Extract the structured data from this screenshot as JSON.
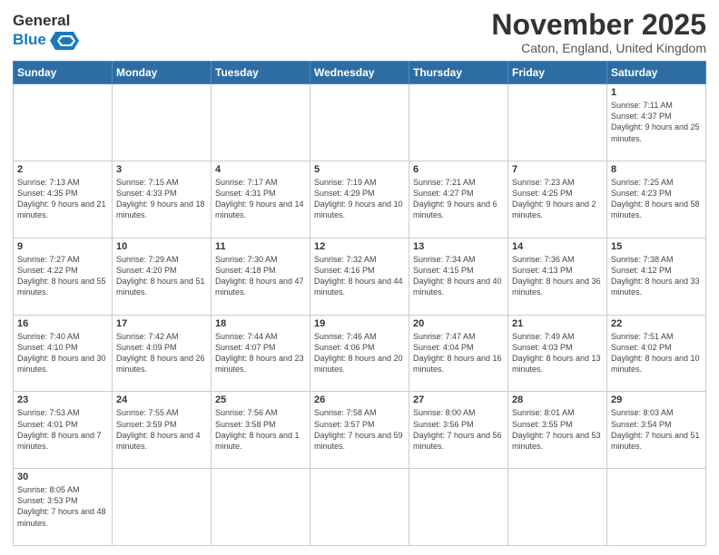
{
  "logo": {
    "text_general": "General",
    "text_blue": "Blue"
  },
  "header": {
    "title": "November 2025",
    "subtitle": "Caton, England, United Kingdom"
  },
  "weekdays": [
    "Sunday",
    "Monday",
    "Tuesday",
    "Wednesday",
    "Thursday",
    "Friday",
    "Saturday"
  ],
  "weeks": [
    [
      {
        "day": "",
        "info": ""
      },
      {
        "day": "",
        "info": ""
      },
      {
        "day": "",
        "info": ""
      },
      {
        "day": "",
        "info": ""
      },
      {
        "day": "",
        "info": ""
      },
      {
        "day": "",
        "info": ""
      },
      {
        "day": "1",
        "info": "Sunrise: 7:11 AM\nSunset: 4:37 PM\nDaylight: 9 hours and 25 minutes."
      }
    ],
    [
      {
        "day": "2",
        "info": "Sunrise: 7:13 AM\nSunset: 4:35 PM\nDaylight: 9 hours and 21 minutes."
      },
      {
        "day": "3",
        "info": "Sunrise: 7:15 AM\nSunset: 4:33 PM\nDaylight: 9 hours and 18 minutes."
      },
      {
        "day": "4",
        "info": "Sunrise: 7:17 AM\nSunset: 4:31 PM\nDaylight: 9 hours and 14 minutes."
      },
      {
        "day": "5",
        "info": "Sunrise: 7:19 AM\nSunset: 4:29 PM\nDaylight: 9 hours and 10 minutes."
      },
      {
        "day": "6",
        "info": "Sunrise: 7:21 AM\nSunset: 4:27 PM\nDaylight: 9 hours and 6 minutes."
      },
      {
        "day": "7",
        "info": "Sunrise: 7:23 AM\nSunset: 4:25 PM\nDaylight: 9 hours and 2 minutes."
      },
      {
        "day": "8",
        "info": "Sunrise: 7:25 AM\nSunset: 4:23 PM\nDaylight: 8 hours and 58 minutes."
      }
    ],
    [
      {
        "day": "9",
        "info": "Sunrise: 7:27 AM\nSunset: 4:22 PM\nDaylight: 8 hours and 55 minutes."
      },
      {
        "day": "10",
        "info": "Sunrise: 7:29 AM\nSunset: 4:20 PM\nDaylight: 8 hours and 51 minutes."
      },
      {
        "day": "11",
        "info": "Sunrise: 7:30 AM\nSunset: 4:18 PM\nDaylight: 8 hours and 47 minutes."
      },
      {
        "day": "12",
        "info": "Sunrise: 7:32 AM\nSunset: 4:16 PM\nDaylight: 8 hours and 44 minutes."
      },
      {
        "day": "13",
        "info": "Sunrise: 7:34 AM\nSunset: 4:15 PM\nDaylight: 8 hours and 40 minutes."
      },
      {
        "day": "14",
        "info": "Sunrise: 7:36 AM\nSunset: 4:13 PM\nDaylight: 8 hours and 36 minutes."
      },
      {
        "day": "15",
        "info": "Sunrise: 7:38 AM\nSunset: 4:12 PM\nDaylight: 8 hours and 33 minutes."
      }
    ],
    [
      {
        "day": "16",
        "info": "Sunrise: 7:40 AM\nSunset: 4:10 PM\nDaylight: 8 hours and 30 minutes."
      },
      {
        "day": "17",
        "info": "Sunrise: 7:42 AM\nSunset: 4:09 PM\nDaylight: 8 hours and 26 minutes."
      },
      {
        "day": "18",
        "info": "Sunrise: 7:44 AM\nSunset: 4:07 PM\nDaylight: 8 hours and 23 minutes."
      },
      {
        "day": "19",
        "info": "Sunrise: 7:46 AM\nSunset: 4:06 PM\nDaylight: 8 hours and 20 minutes."
      },
      {
        "day": "20",
        "info": "Sunrise: 7:47 AM\nSunset: 4:04 PM\nDaylight: 8 hours and 16 minutes."
      },
      {
        "day": "21",
        "info": "Sunrise: 7:49 AM\nSunset: 4:03 PM\nDaylight: 8 hours and 13 minutes."
      },
      {
        "day": "22",
        "info": "Sunrise: 7:51 AM\nSunset: 4:02 PM\nDaylight: 8 hours and 10 minutes."
      }
    ],
    [
      {
        "day": "23",
        "info": "Sunrise: 7:53 AM\nSunset: 4:01 PM\nDaylight: 8 hours and 7 minutes."
      },
      {
        "day": "24",
        "info": "Sunrise: 7:55 AM\nSunset: 3:59 PM\nDaylight: 8 hours and 4 minutes."
      },
      {
        "day": "25",
        "info": "Sunrise: 7:56 AM\nSunset: 3:58 PM\nDaylight: 8 hours and 1 minute."
      },
      {
        "day": "26",
        "info": "Sunrise: 7:58 AM\nSunset: 3:57 PM\nDaylight: 7 hours and 59 minutes."
      },
      {
        "day": "27",
        "info": "Sunrise: 8:00 AM\nSunset: 3:56 PM\nDaylight: 7 hours and 56 minutes."
      },
      {
        "day": "28",
        "info": "Sunrise: 8:01 AM\nSunset: 3:55 PM\nDaylight: 7 hours and 53 minutes."
      },
      {
        "day": "29",
        "info": "Sunrise: 8:03 AM\nSunset: 3:54 PM\nDaylight: 7 hours and 51 minutes."
      }
    ],
    [
      {
        "day": "30",
        "info": "Sunrise: 8:05 AM\nSunset: 3:53 PM\nDaylight: 7 hours and 48 minutes."
      },
      {
        "day": "",
        "info": ""
      },
      {
        "day": "",
        "info": ""
      },
      {
        "day": "",
        "info": ""
      },
      {
        "day": "",
        "info": ""
      },
      {
        "day": "",
        "info": ""
      },
      {
        "day": "",
        "info": ""
      }
    ]
  ]
}
